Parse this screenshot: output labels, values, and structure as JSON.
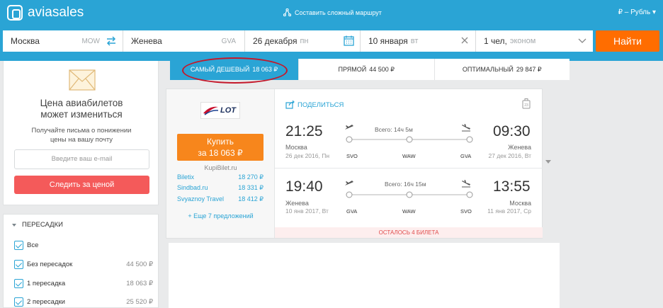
{
  "header": {
    "brand": "aviasales",
    "route_link": "Составить сложный маршрут",
    "currency": "₽ – Рубль"
  },
  "search": {
    "origin": "Москва",
    "origin_code": "MOW",
    "destination": "Женева",
    "destination_code": "GVA",
    "depart_date": "26 декабря",
    "depart_weekday": "пн",
    "return_date": "10 января",
    "return_weekday": "вт",
    "passengers": "1 чел,",
    "cabin": "эконом",
    "find_label": "Найти"
  },
  "promo": {
    "title_line1": "Цена авиабилетов",
    "title_line2": "может измениться",
    "sub_line1": "Получайте письма о понижении",
    "sub_line2": "цены на вашу почту",
    "email_placeholder": "Введите ваш e-mail",
    "button": "Следить за ценой"
  },
  "filters": {
    "title": "ПЕРЕСАДКИ",
    "items": [
      {
        "label": "Все",
        "price": ""
      },
      {
        "label": "Без пересадок",
        "price": "44 500 ₽"
      },
      {
        "label": "1 пересадка",
        "price": "18 063 ₽"
      },
      {
        "label": "2 пересадки",
        "price": "25 520 ₽"
      }
    ]
  },
  "tabs": [
    {
      "label": "САМЫЙ ДЕШЕВЫЙ",
      "amount": "18 063 ₽"
    },
    {
      "label": "ПРЯМОЙ",
      "amount": "44 500 ₽"
    },
    {
      "label": "ОПТИМАЛЬНЫЙ",
      "amount": "29 847 ₽"
    }
  ],
  "ticket": {
    "airline_logo_text": "LOT",
    "buy_line1": "Купить",
    "buy_line2": "за 18 063 ₽",
    "agency_top": "KupiBilet.ru",
    "agencies": [
      {
        "name": "Biletix",
        "price": "18 270 ₽"
      },
      {
        "name": "Sindbad.ru",
        "price": "18 331 ₽"
      },
      {
        "name": "Svyaznoy Travel",
        "price": "18 412 ₽"
      }
    ],
    "more": "+ Еще 7 предложений",
    "share": "ПОДЕЛИТЬСЯ",
    "remaining": "ОСТАЛОСЬ 4 БИЛЕТА",
    "outbound": {
      "dep_time": "21:25",
      "dep_city": "Москва",
      "dep_date": "26 дек 2016, Пн",
      "arr_time": "09:30",
      "arr_city": "Женева",
      "arr_date": "27 дек 2016, Вт",
      "total": "Всего: 14ч 5м",
      "codes": [
        "SVO",
        "WAW",
        "GVA"
      ]
    },
    "inbound": {
      "dep_time": "19:40",
      "dep_city": "Женева",
      "dep_date": "10 янв 2017, Вт",
      "arr_time": "13:55",
      "arr_city": "Москва",
      "arr_date": "11 янв 2017, Ср",
      "total": "Всего: 16ч 15м",
      "codes": [
        "GVA",
        "WAW",
        "SVO"
      ]
    }
  },
  "colors": {
    "brand_blue": "#2aa4d5",
    "find_orange": "#ff6d00",
    "buy_orange": "#f7861c",
    "track_red": "#f45a5a",
    "highlight_red": "#c4182a"
  }
}
